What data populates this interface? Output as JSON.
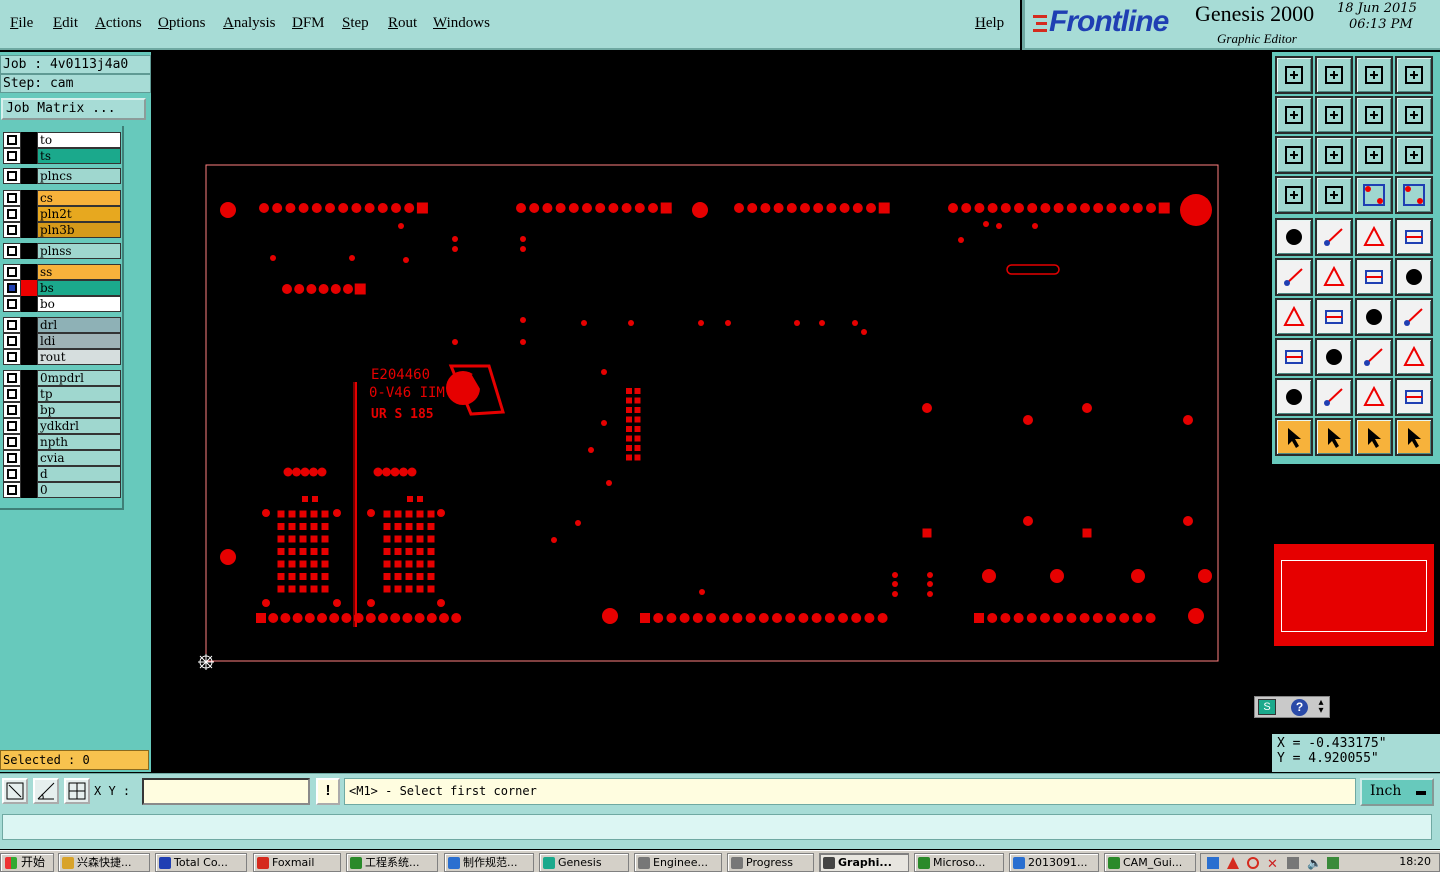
{
  "menubar": {
    "items": [
      "File",
      "Edit",
      "Actions",
      "Options",
      "Analysis",
      "DFM",
      "Step",
      "Rout",
      "Windows"
    ],
    "help": "Help"
  },
  "brand": {
    "logo": "Frontline",
    "product": "Genesis 2000",
    "subtitle": "Graphic Editor",
    "date": "18 Jun 2015",
    "time": "06:13 PM"
  },
  "job": {
    "job_line": "Job : 4v0113j4a0",
    "step_line": "Step: cam",
    "matrix_button": "Job Matrix ...",
    "selected": "Selected : 0"
  },
  "layers": [
    {
      "name": "to",
      "color": "#ffffff"
    },
    {
      "name": "ts",
      "color": "#1ba98c"
    },
    {
      "name": "plncs",
      "color": "#9fd7cf"
    },
    {
      "name": "cs",
      "color": "#f7b23b"
    },
    {
      "name": "pln2t",
      "color": "#e7a81f"
    },
    {
      "name": "pln3b",
      "color": "#d59a1a"
    },
    {
      "name": "plnss",
      "color": "#9fd7cf"
    },
    {
      "name": "ss",
      "color": "#f7b23b"
    },
    {
      "name": "bs",
      "color": "#1ba98c",
      "active": true
    },
    {
      "name": "bo",
      "color": "#ffffff"
    },
    {
      "name": "drl",
      "color": "#8eb1b6"
    },
    {
      "name": "ldi",
      "color": "#9fb3b6"
    },
    {
      "name": "rout",
      "color": "#d6dede"
    },
    {
      "name": "0mpdrl",
      "color": "#9fd7cf"
    },
    {
      "name": "tp",
      "color": "#9fd7cf"
    },
    {
      "name": "bp",
      "color": "#9fd7cf"
    },
    {
      "name": "ydkdrl",
      "color": "#9fd7cf"
    },
    {
      "name": "npth",
      "color": "#9fd7cf"
    },
    {
      "name": "cvia",
      "color": "#9fd7cf"
    },
    {
      "name": "d",
      "color": "#9fd7cf"
    },
    {
      "name": "0",
      "color": "#9fd7cf"
    }
  ],
  "board": {
    "marking_lines": [
      "E204460",
      "0-V46 IIM",
      "UR S 185"
    ]
  },
  "coords": {
    "x": "X = -0.433175\"",
    "y": "Y = 4.920055\""
  },
  "cmd": {
    "xy_label": "X Y :",
    "xy_value": "",
    "bang": "!",
    "prompt": "<M1> - Select first corner",
    "unit": "Inch"
  },
  "taskbar": {
    "start": "开始",
    "tasks": [
      "兴森快捷...",
      "Total Co...",
      "Foxmail",
      "工程系统...",
      "制作规范...",
      "Genesis",
      "Enginee...",
      "Progress",
      "Graphi...",
      "Microso...",
      "2013091...",
      "CAM_Gui..."
    ],
    "active_task": "Graphi...",
    "clock": "18:20"
  },
  "colors": {
    "panel": "#a7dcd6",
    "panel_dark": "#67c9bc",
    "feature": "#e60000",
    "profile": "#ff8080",
    "frontline_blue": "#1f3fb3"
  }
}
